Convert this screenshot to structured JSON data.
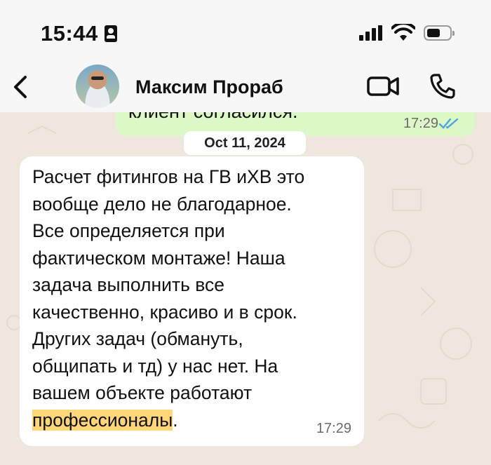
{
  "status_bar": {
    "time": "15:44"
  },
  "header": {
    "contact_name": "Максим Прораб"
  },
  "chat": {
    "outgoing_partial": {
      "text": "клиент согласился.",
      "time": "17:29"
    },
    "date_separator": "Oct 11, 2024",
    "incoming": {
      "text": "Расчет фитингов на ГВ иХВ это\nвообще дело не благодарное.\nВсе определяется при\nфактическом монтаже! Наша\nзадача выполнить все\nкачественно, красиво и в срок.\nДругих задач (обмануть,\nобщипать и тд) у нас нет. На\nвашем объекте работают\n",
      "highlighted": "профессионалы",
      "tail": ".",
      "time": "17:29"
    }
  },
  "icons": [
    "back-icon",
    "video-call-icon",
    "voice-call-icon",
    "signal-icon",
    "wifi-icon",
    "battery-icon",
    "id-card-icon",
    "read-receipt-icon"
  ],
  "colors": {
    "outgoing_bubble": "#dbf8c6",
    "incoming_bubble": "#ffffff",
    "highlight": "#ffd67a",
    "read_ticks": "#4fa3e0",
    "chat_background": "#efe7dd"
  }
}
